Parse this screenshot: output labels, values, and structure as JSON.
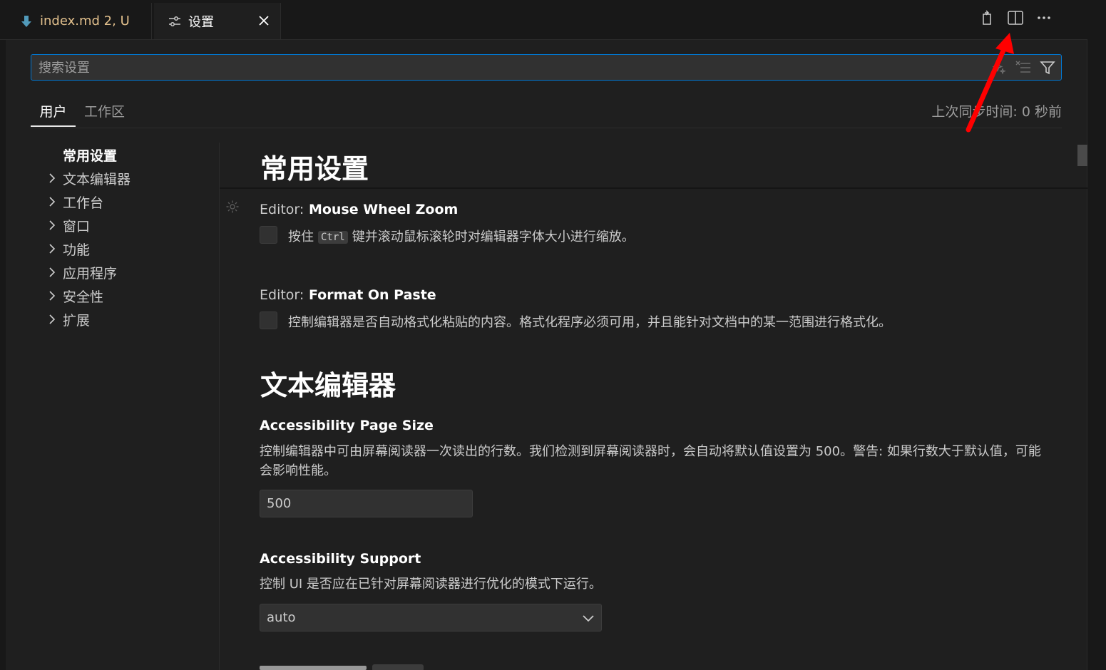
{
  "tabs": [
    {
      "label": "index.md",
      "status": "2, U",
      "icon": "markdown-arrow-icon"
    },
    {
      "label": "设置",
      "icon": "settings-sliders-icon"
    }
  ],
  "search": {
    "placeholder": "搜索设置"
  },
  "scopes": {
    "user": "用户",
    "workspace": "工作区"
  },
  "sync_status": "上次同步时间: 0 秒前",
  "toc": {
    "top": "常用设置",
    "items": [
      "文本编辑器",
      "工作台",
      "窗口",
      "功能",
      "应用程序",
      "安全性",
      "扩展"
    ]
  },
  "sections": {
    "common": "常用设置",
    "text_editor": "文本编辑器"
  },
  "settings": {
    "mouse_wheel_zoom": {
      "category": "Editor:",
      "name": "Mouse Wheel Zoom",
      "desc_before": "按住",
      "key": "Ctrl",
      "desc_after": "键并滚动鼠标滚轮时对编辑器字体大小进行缩放。",
      "checked": false
    },
    "format_on_paste": {
      "category": "Editor:",
      "name": "Format On Paste",
      "desc": "控制编辑器是否自动格式化粘贴的内容。格式化程序必须可用，并且能针对文档中的某一范围进行格式化。",
      "checked": false
    },
    "accessibility_page_size": {
      "name": "Accessibility Page Size",
      "desc": "控制编辑器中可由屏幕阅读器一次读出的行数。我们检测到屏幕阅读器时，会自动将默认值设置为 500。警告: 如果行数大于默认值，可能会影响性能。",
      "value": "500"
    },
    "accessibility_support": {
      "name": "Accessibility Support",
      "desc": "控制 UI 是否应在已针对屏幕阅读器进行优化的模式下运行。",
      "value": "auto"
    }
  },
  "colors": {
    "accent": "#0078d4",
    "modified": "#e2c08d",
    "annotation_arrow": "#ff0000"
  }
}
